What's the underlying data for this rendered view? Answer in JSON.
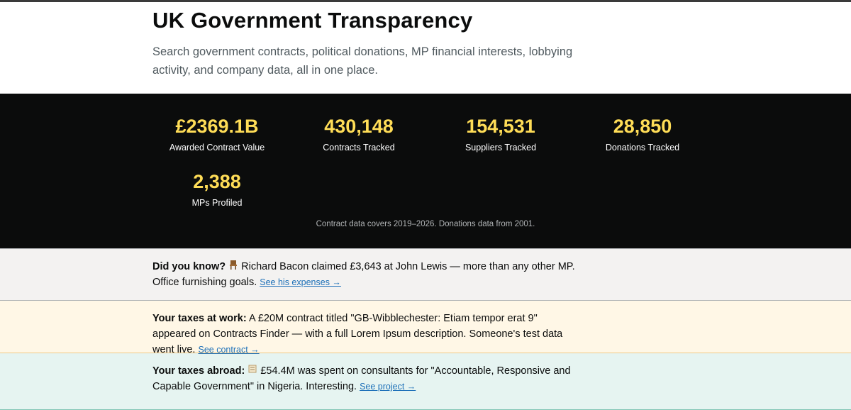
{
  "header": {
    "title": "UK Government Transparency",
    "subtitle": "Search government contracts, political donations, MP financial interests, lobbying activity, and company data, all in one place."
  },
  "stats": [
    {
      "value": "£2369.1B",
      "label": "Awarded Contract Value"
    },
    {
      "value": "430,148",
      "label": "Contracts Tracked"
    },
    {
      "value": "154,531",
      "label": "Suppliers Tracked"
    },
    {
      "value": "28,850",
      "label": "Donations Tracked"
    },
    {
      "value": "2,388",
      "label": "MPs Profiled"
    }
  ],
  "coverage_note": "Contract data covers 2019–2026. Donations data from 2001.",
  "facts": [
    {
      "heading": "Did you know?",
      "icon": "chair-icon",
      "text": "Richard Bacon claimed £3,643 at John Lewis — more than any other MP. Office furnishing goals.",
      "link": "See his expenses →"
    },
    {
      "heading": "Your taxes at work:",
      "text": "A £20M contract titled \"GB-Wibblechester: Etiam tempor erat 9\" appeared on Contracts Finder — with a full Lorem Ipsum description. Someone's test data went live.",
      "link": "See contract →"
    },
    {
      "heading": "Your taxes abroad:",
      "icon": "scroll-icon",
      "text": "£54.4M was spent on consultants for \"Accountable, Responsive and Capable Government\" in Nigeria. Interesting.",
      "link": "See project →"
    }
  ],
  "colors": {
    "accent_yellow": "#ffdd57",
    "stats_bg": "#0b0c0c",
    "link": "#1d70b8",
    "fact1_bg": "#f3f2f1",
    "fact2_bg": "#fff7e6",
    "fact3_bg": "#e6f4f1"
  }
}
